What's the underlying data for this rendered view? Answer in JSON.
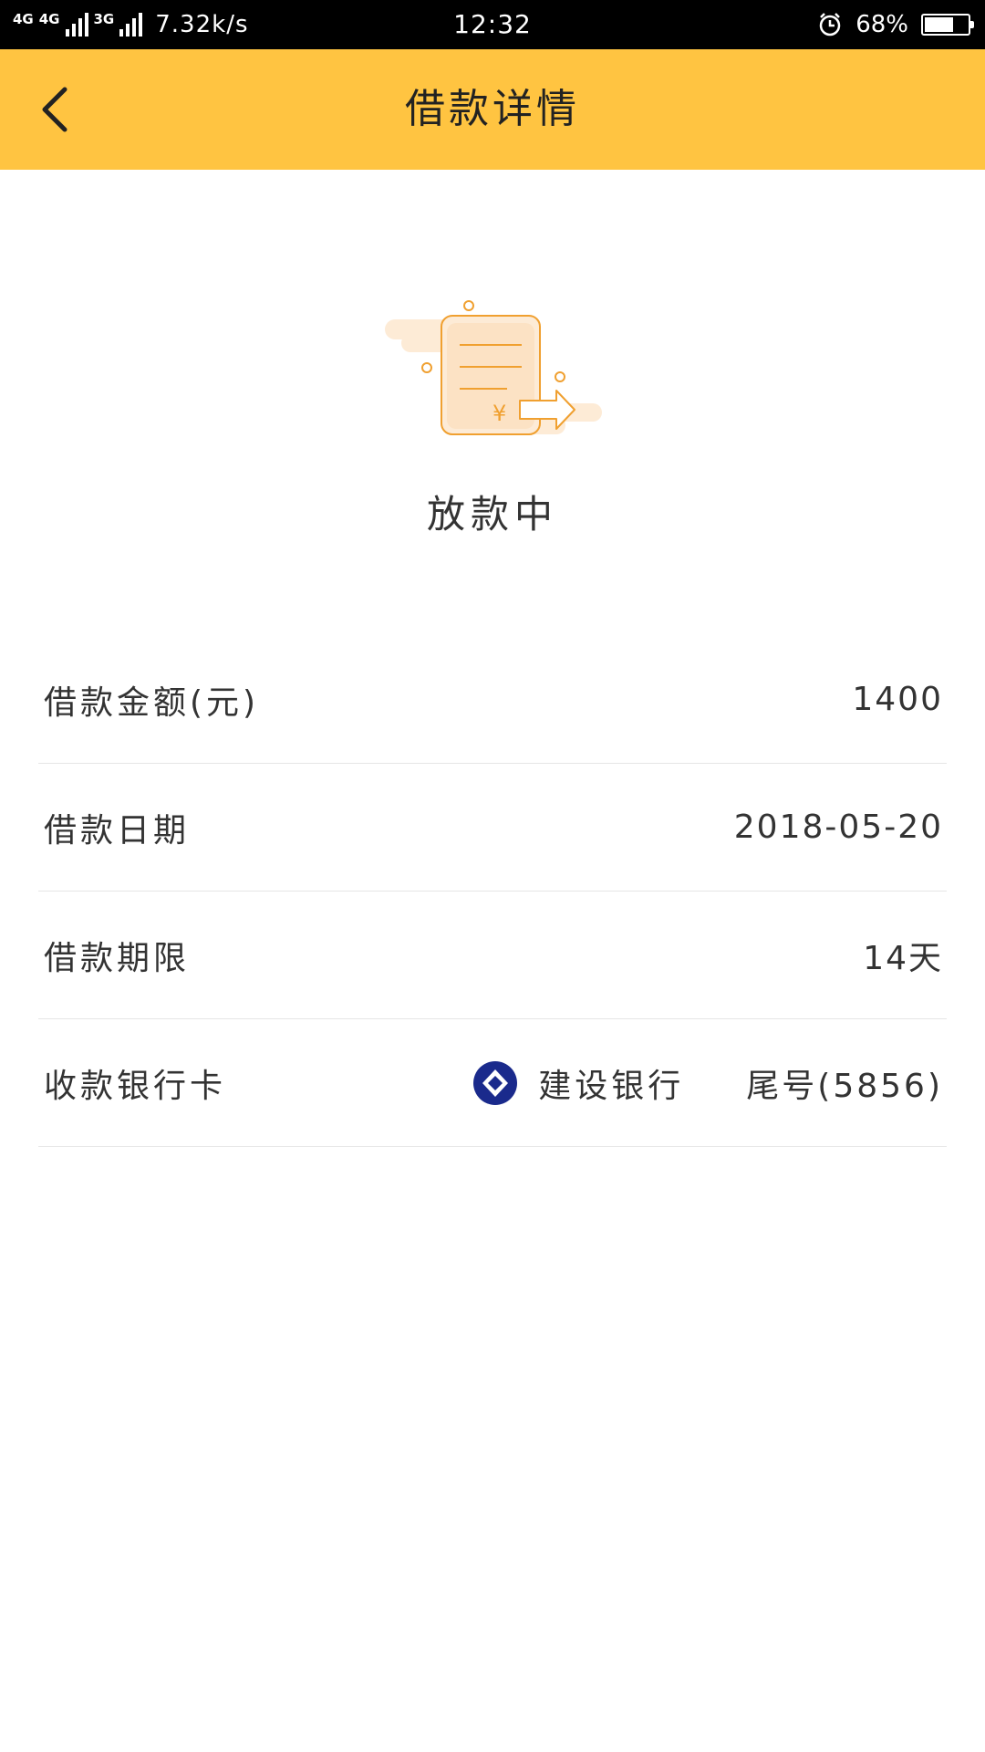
{
  "status_bar": {
    "network_1": "4G",
    "network_2": "4G",
    "network_3": "3G",
    "speed": "7.32k/s",
    "time": "12:32",
    "battery_pct": "68%",
    "battery_level": 0.68
  },
  "header": {
    "title": "借款详情",
    "back_icon": "chevron-left-icon",
    "background": "#FFC441"
  },
  "status": {
    "illustration_icon": "document-transfer-icon",
    "text": "放款中",
    "accent": "#F0A030"
  },
  "details": {
    "rows": [
      {
        "label": "借款金额(元)",
        "value": "1400"
      },
      {
        "label": "借款日期",
        "value": "2018-05-20"
      },
      {
        "label": "借款期限",
        "value": "14天"
      },
      {
        "label": "收款银行卡",
        "bank_name": "建设银行",
        "card_tail": "尾号(5856)",
        "bank_icon": "ccb-logo-icon",
        "bank_color": "#1A2A8C"
      }
    ]
  }
}
